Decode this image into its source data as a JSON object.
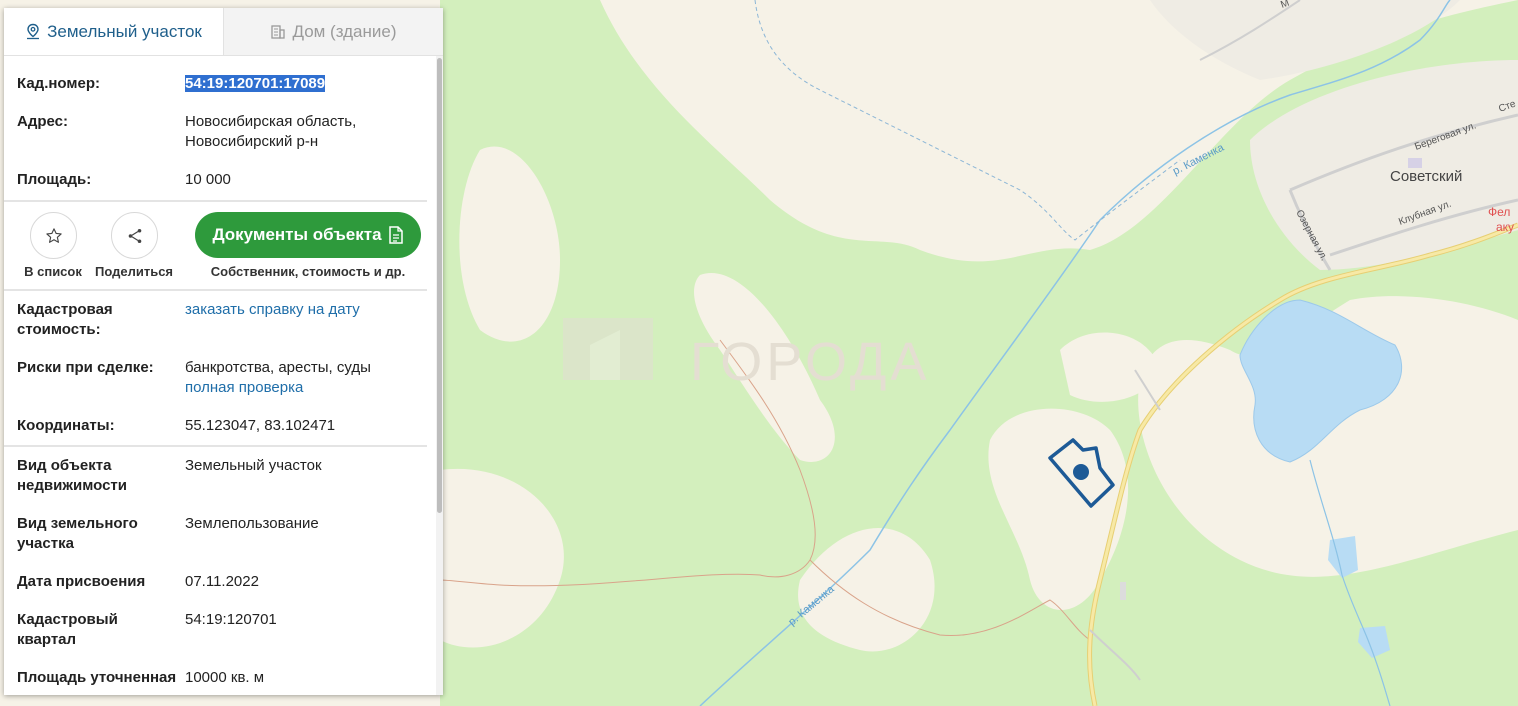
{
  "tabs": {
    "land": "Земельный участок",
    "building": "Дом (здание)"
  },
  "fields": {
    "cad_number": {
      "label": "Кад.номер:",
      "value": "54:19:120701:17089"
    },
    "address": {
      "label": "Адрес:",
      "line1": "Новосибирская область,",
      "line2": "Новосибирский р-н"
    },
    "area": {
      "label": "Площадь:",
      "value": "10 000"
    },
    "cad_cost": {
      "label1": "Кадастровая",
      "label2": "стоимость:",
      "value": "заказать справку на дату"
    },
    "risks": {
      "label": "Риски при сделке:",
      "line1": "банкротства, аресты, суды",
      "link": "полная проверка"
    },
    "coords": {
      "label": "Координаты:",
      "value": "55.123047, 83.102471"
    },
    "object_type": {
      "label1": "Вид объекта",
      "label2": "недвижимости",
      "value": "Земельный участок"
    },
    "land_type": {
      "label1": "Вид земельного",
      "label2": "участка",
      "value": "Землепользование"
    },
    "date": {
      "label": "Дата присвоения",
      "value": "07.11.2022"
    },
    "quarter": {
      "label1": "Кадастровый",
      "label2": "квартал",
      "value": "54:19:120701"
    },
    "area_refined": {
      "label": "Площадь уточненная",
      "value": "10000 кв. м"
    }
  },
  "actions": {
    "to_list": "В список",
    "share": "Поделиться",
    "docs_button": "Документы объекта",
    "docs_sub": "Собственник, стоимость и др."
  },
  "map": {
    "watermark": "ГОРОДА",
    "village": "Советский",
    "river1": "р. Каменка",
    "river2": "р. Каменка",
    "street1": "Береговая ул.",
    "street2": "Клубная ул.",
    "street3": "Озерная ул.",
    "street4": "Сте",
    "poi1": "Фел",
    "poi2": "аку",
    "poi3": "М"
  },
  "colors": {
    "forest": "#d3efbd",
    "water": "#b8dcf4",
    "road": "#f5df8a",
    "parcel": "#1d5a96",
    "button": "#2e9a3c",
    "link": "#1f6ea9"
  }
}
